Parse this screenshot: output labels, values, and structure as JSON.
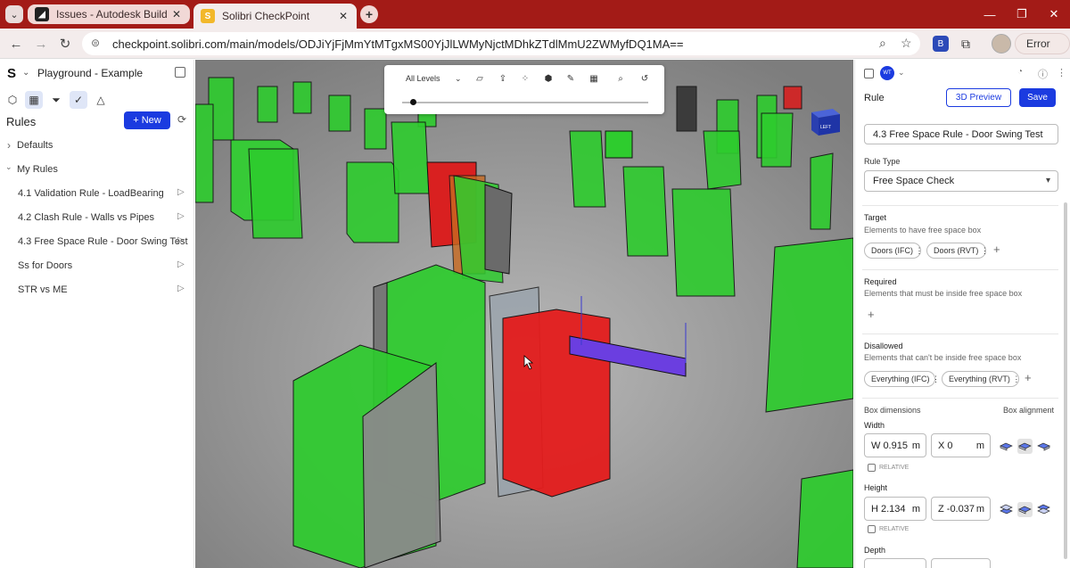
{
  "browser": {
    "tabs": [
      {
        "title": "Issues - Autodesk Build",
        "favicon": "autodesk-icon",
        "active": false
      },
      {
        "title": "Solibri CheckPoint",
        "favicon": "solibri-icon",
        "active": true
      }
    ],
    "url": "checkpoint.solibri.com/main/models/ODJiYjFjMmYtMTgxMS00YjJlLWMyNjctMDhkZTdlMmU2ZWMyfDQ1MA==",
    "error_label": "Error",
    "tab_menu_glyph": "⌄",
    "new_tab_glyph": "+",
    "close_glyph": "✕",
    "window_controls": [
      "—",
      "❐",
      "✕"
    ],
    "nav_glyphs": {
      "back": "←",
      "forward": "→",
      "reload": "↻"
    },
    "url_glyphs": {
      "site": "⊜",
      "zoom": "⌕",
      "bookmark": "☆"
    },
    "extension_glyphs": {
      "ext1": "B",
      "puzzle": "⧉",
      "more": "⋮"
    }
  },
  "left_panel": {
    "logo": "S",
    "project_name": "Playground - Example",
    "rules_title": "Rules",
    "new_button": "+ New",
    "tree": {
      "defaults_label": "Defaults",
      "my_rules_label": "My Rules",
      "rules": [
        "4.1 Validation Rule - LoadBearing",
        "4.2 Clash Rule - Walls vs Pipes",
        "4.3 Free Space Rule - Door Swing Test",
        "Ss for Doors",
        "STR vs ME"
      ]
    },
    "glyphs": {
      "chevron_down": "⌄",
      "chevron_right": "›",
      "play": "▷",
      "refresh": "⟳"
    },
    "tool_icons": [
      {
        "name": "cube-icon",
        "glyph": "⬡"
      },
      {
        "name": "layout-icon",
        "glyph": "▦"
      },
      {
        "name": "filter-icon",
        "glyph": "⏷"
      },
      {
        "name": "check-circle-icon",
        "glyph": "✓"
      },
      {
        "name": "warning-triangle-icon",
        "glyph": "△"
      }
    ]
  },
  "viewport_toolbar": {
    "levels_label": "All Levels",
    "chevron": "⌄",
    "icons": [
      {
        "name": "map-icon",
        "glyph": "▱"
      },
      {
        "name": "upload-icon",
        "glyph": "⇪"
      },
      {
        "name": "select-icon",
        "glyph": "⁘"
      },
      {
        "name": "box-icon",
        "glyph": "⬢"
      },
      {
        "name": "measure-icon",
        "glyph": "✎"
      },
      {
        "name": "section-icon",
        "glyph": "▦"
      },
      {
        "name": "zoom-icon",
        "glyph": "⌕"
      },
      {
        "name": "reset-icon",
        "glyph": "↺"
      }
    ],
    "navcube_label": "LEFT"
  },
  "right_panel": {
    "avatar_initials": "WT",
    "panel_title": "Rule",
    "preview_button": "3D Preview",
    "save_button": "Save",
    "rule_name": "4.3 Free Space Rule - Door Swing Test",
    "rule_type_label": "Rule Type",
    "rule_type_value": "Free Space Check",
    "target": {
      "title": "Target",
      "desc": "Elements to have free space box",
      "chips": [
        "Doors (IFC) ⋮",
        "Doors (RVT) ⋮"
      ]
    },
    "required": {
      "title": "Required",
      "desc": "Elements that must be inside free space box"
    },
    "disallowed": {
      "title": "Disallowed",
      "desc": "Elements that can't be inside free space box",
      "chips": [
        "Everything (IFC) ⋮",
        "Everything (RVT) ⋮"
      ]
    },
    "box_dimensions_label": "Box dimensions",
    "box_alignment_label": "Box alignment",
    "width": {
      "label": "Width",
      "value": "W 0.915",
      "unit": "m",
      "offset": "X 0",
      "offset_unit": "m"
    },
    "height": {
      "label": "Height",
      "value": "H 2.134",
      "unit": "m",
      "offset": "Z -0.037",
      "offset_unit": "m"
    },
    "relative_label": "RELATIVE",
    "depth_label": "Depth",
    "glyphs": {
      "plus": "+",
      "dropdown": "▾",
      "bell": "🔔",
      "info": "ⓘ",
      "more": "⋮"
    }
  }
}
